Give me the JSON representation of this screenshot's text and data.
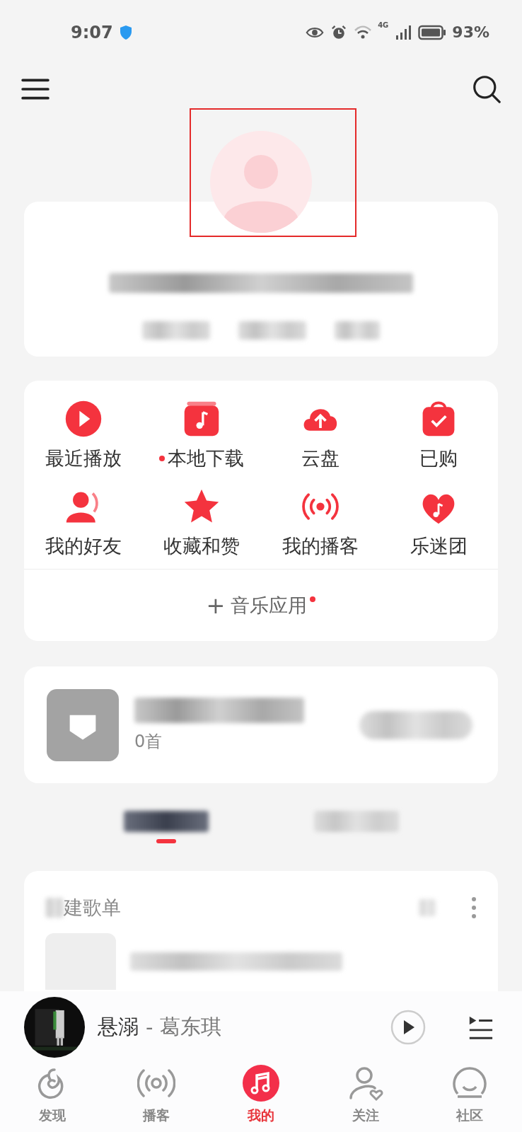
{
  "status_bar": {
    "time": "9:07",
    "battery": "93%",
    "network": "4G"
  },
  "quick_grid": [
    {
      "label": "最近播放",
      "dot": false
    },
    {
      "label": "本地下载",
      "dot": true
    },
    {
      "label": "云盘",
      "dot": false
    },
    {
      "label": "已购",
      "dot": false
    },
    {
      "label": "我的好友",
      "dot": false
    },
    {
      "label": "收藏和赞",
      "dot": false
    },
    {
      "label": "我的播客",
      "dot": false
    },
    {
      "label": "乐迷团",
      "dot": false
    }
  ],
  "music_apps": {
    "icon": "+",
    "label": "音乐应用",
    "dot": true
  },
  "liked_music": {
    "count": "0首"
  },
  "playlist_tabs": [
    {
      "selected": true
    },
    {
      "selected": false
    }
  ],
  "playlist_section": {
    "title": "建歌单"
  },
  "now_playing": {
    "song": "悬溺",
    "separator": "-",
    "artist": "葛东琪"
  },
  "bottom_nav": [
    {
      "label": "发现",
      "selected": false
    },
    {
      "label": "播客",
      "selected": false
    },
    {
      "label": "我的",
      "selected": true
    },
    {
      "label": "关注",
      "selected": false
    },
    {
      "label": "社区",
      "selected": false
    }
  ]
}
